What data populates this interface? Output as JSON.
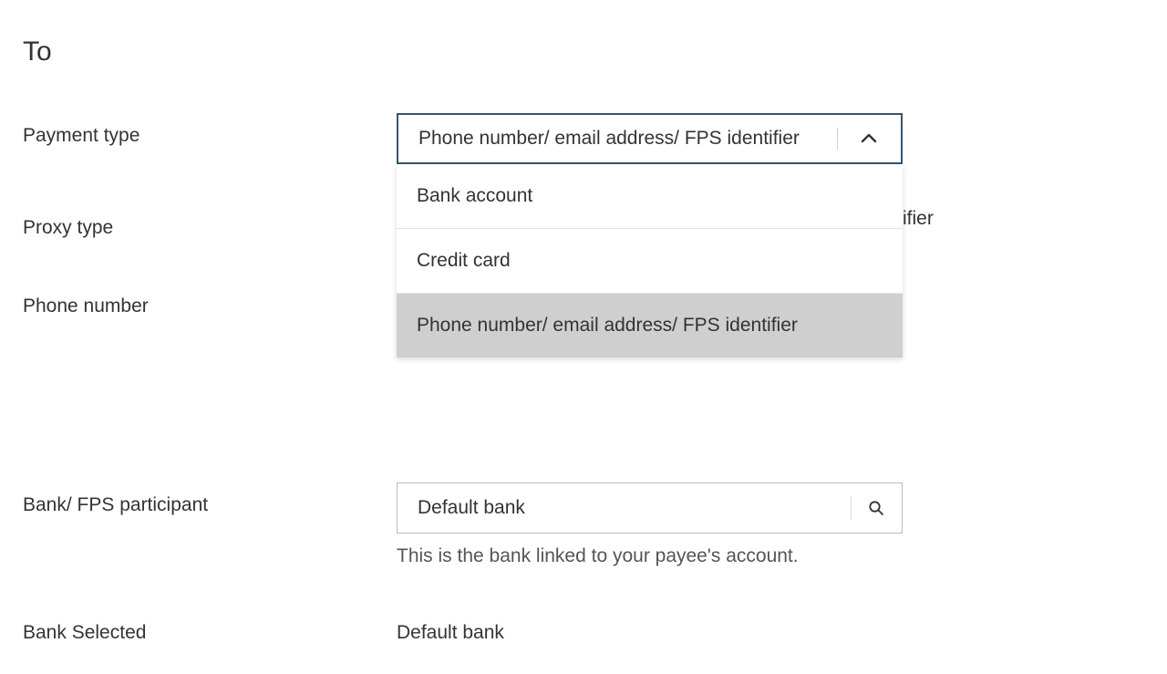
{
  "section": {
    "title": "To"
  },
  "labels": {
    "payment_type": "Payment type",
    "proxy_type": "Proxy type",
    "phone_number": "Phone number",
    "bank_participant": "Bank/ FPS participant",
    "bank_selected": "Bank Selected"
  },
  "payment_type": {
    "selected": "Phone number/ email address/ FPS identifier",
    "options": [
      "Bank account",
      "Credit card",
      "Phone number/ email address/ FPS identifier"
    ]
  },
  "proxy_type": {
    "peek_fragment": "ifier"
  },
  "bank_participant": {
    "value": "Default bank",
    "helper": "This is the bank linked to your payee's account."
  },
  "bank_selected": {
    "value": "Default bank"
  }
}
